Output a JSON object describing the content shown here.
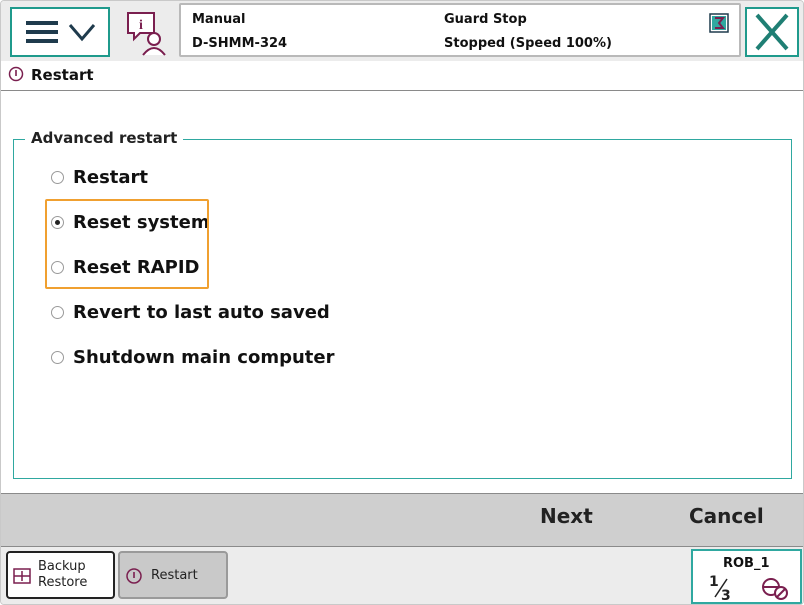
{
  "header": {
    "menu_icon": "hamburger-chevron-icon",
    "info_icon": "info-user-icon",
    "mode": "Manual",
    "system_name": "D-SHMM-324",
    "state": "Guard Stop",
    "speed_status": "Stopped (Speed 100%)",
    "status_flag_icon": "event-flag-icon",
    "close_icon": "close-icon"
  },
  "title": {
    "icon": "restart-icon",
    "text": "Restart"
  },
  "advanced_restart": {
    "legend": "Advanced restart",
    "options": [
      {
        "label": "Restart",
        "checked": false
      },
      {
        "label": "Reset system",
        "checked": true
      },
      {
        "label": "Reset RAPID",
        "checked": false
      },
      {
        "label": "Revert to last auto saved",
        "checked": false
      },
      {
        "label": "Shutdown main computer",
        "checked": false
      }
    ]
  },
  "commands": {
    "next": "Next",
    "cancel": "Cancel"
  },
  "taskbar": {
    "backup_line1": "Backup",
    "backup_line2": "Restore",
    "backup_icon": "backup-restore-icon",
    "restart_label": "Restart",
    "restart_icon": "restart-icon",
    "rob_label": "ROB_1",
    "rob_fraction_icon": "one-third-icon",
    "rob_jog_icon": "jogging-icon"
  },
  "colors": {
    "accent": "#1f9a8c",
    "highlight": "#f0a030",
    "command_bar": "#cfcfcf"
  }
}
